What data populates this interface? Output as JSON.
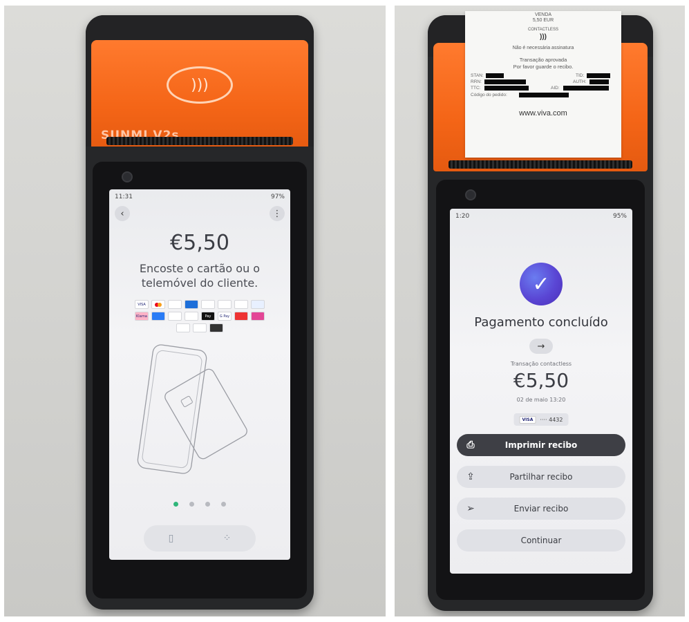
{
  "left_terminal": {
    "brand": "SUNMI V2s",
    "status": {
      "time": "11:31",
      "battery": "97%"
    },
    "amount": "€5,50",
    "instruction": "Encoste o cartão ou o telemóvel do cliente.",
    "payment_logos": [
      "VISA",
      "",
      "",
      "",
      "",
      "",
      "",
      "",
      "",
      "",
      "Klarna",
      "",
      "",
      "",
      "Pay",
      "G Pay",
      "",
      "",
      "",
      "",
      ""
    ],
    "page_dots": 4,
    "active_dot": 0
  },
  "right_terminal": {
    "status": {
      "time": "1:20",
      "battery": "95%"
    },
    "receipt": {
      "header1": "VENDA",
      "header2": "5,50 EUR",
      "mode": "CONTACTLESS",
      "nfc_symbol": ")))",
      "signature_note": "Não é necessária assinatura",
      "approved": "Transação aprovada",
      "keep": "Por favor guarde o recibo.",
      "stan_label": "STAN:",
      "tid_label": "TID:",
      "rrn_label": "RRN:",
      "auth_label": "AUTH:",
      "ttc_label": "TTC:",
      "aid_label": "AID:",
      "order_label": "Código do pedido:",
      "website": "www.viva.com"
    },
    "title": "Pagamento concluído",
    "transaction_type": "Transação contactless",
    "amount": "€5,50",
    "datetime": "02 de maio 13:20",
    "card_brand": "VISA",
    "card_masked": "···· 4432",
    "actions": {
      "print": "Imprimir recibo",
      "share": "Partilhar recibo",
      "send": "Enviar recibo",
      "continue": "Continuar"
    }
  }
}
